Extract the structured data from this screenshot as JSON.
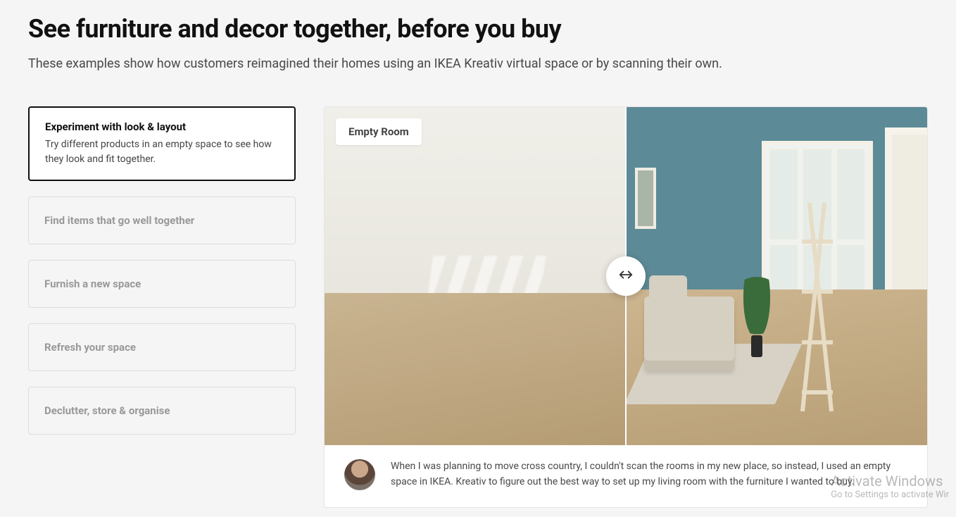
{
  "heading": "See furniture and decor together, before you buy",
  "subheading": "These examples show how customers reimagined their homes using an IKEA Kreativ virtual space or by scanning their own.",
  "options": [
    {
      "title": "Experiment with look & layout",
      "desc": "Try different products in an empty space to see how they look and fit together.",
      "active": true
    },
    {
      "title": "Find items that go well together",
      "active": false
    },
    {
      "title": "Furnish a new space",
      "active": false
    },
    {
      "title": "Refresh your space",
      "active": false
    },
    {
      "title": "Declutter, store & organise",
      "active": false
    }
  ],
  "viewer": {
    "badge": "Empty Room"
  },
  "testimonial": {
    "quote": "When I was planning to move cross country, I couldn't scan the rooms in my new place, so instead, I used an empty space in IKEA. Kreativ to figure out the best way to set up my living room with the furniture I wanted to buy."
  },
  "watermark": {
    "title": "Activate Windows",
    "sub": "Go to Settings to activate Wir"
  }
}
